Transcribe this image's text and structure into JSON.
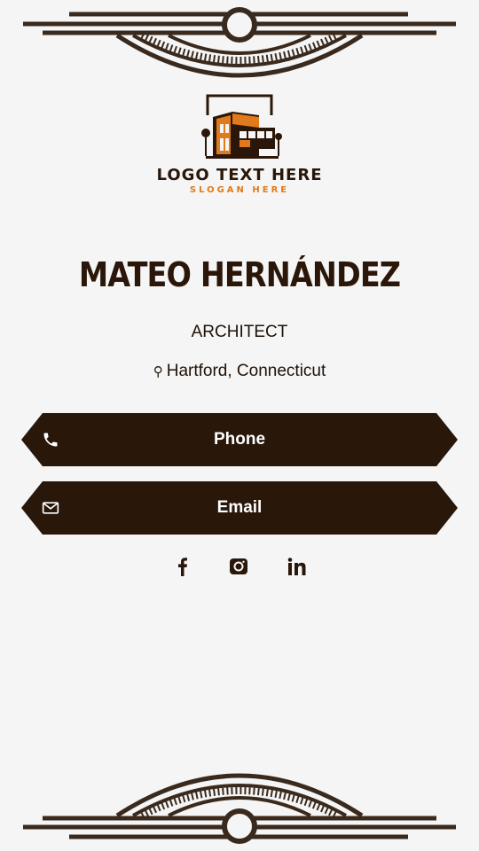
{
  "logo": {
    "text": "LOGO TEXT HERE",
    "slogan": "SLOGAN HERE"
  },
  "profile": {
    "name": "MATEO HERNÁNDEZ",
    "title": "ARCHITECT",
    "location": "Hartford, Connecticut",
    "location_icon": "location-pin-icon"
  },
  "buttons": {
    "phone": {
      "label": "Phone",
      "icon": "phone-icon"
    },
    "email": {
      "label": "Email",
      "icon": "mail-icon"
    }
  },
  "socials": [
    {
      "icon": "facebook-icon"
    },
    {
      "icon": "instagram-icon"
    },
    {
      "icon": "linkedin-icon"
    }
  ],
  "colors": {
    "background": "#f5f5f5",
    "dark_brown": "#29170a",
    "orange": "#e07a1c",
    "white": "#ffffff"
  }
}
